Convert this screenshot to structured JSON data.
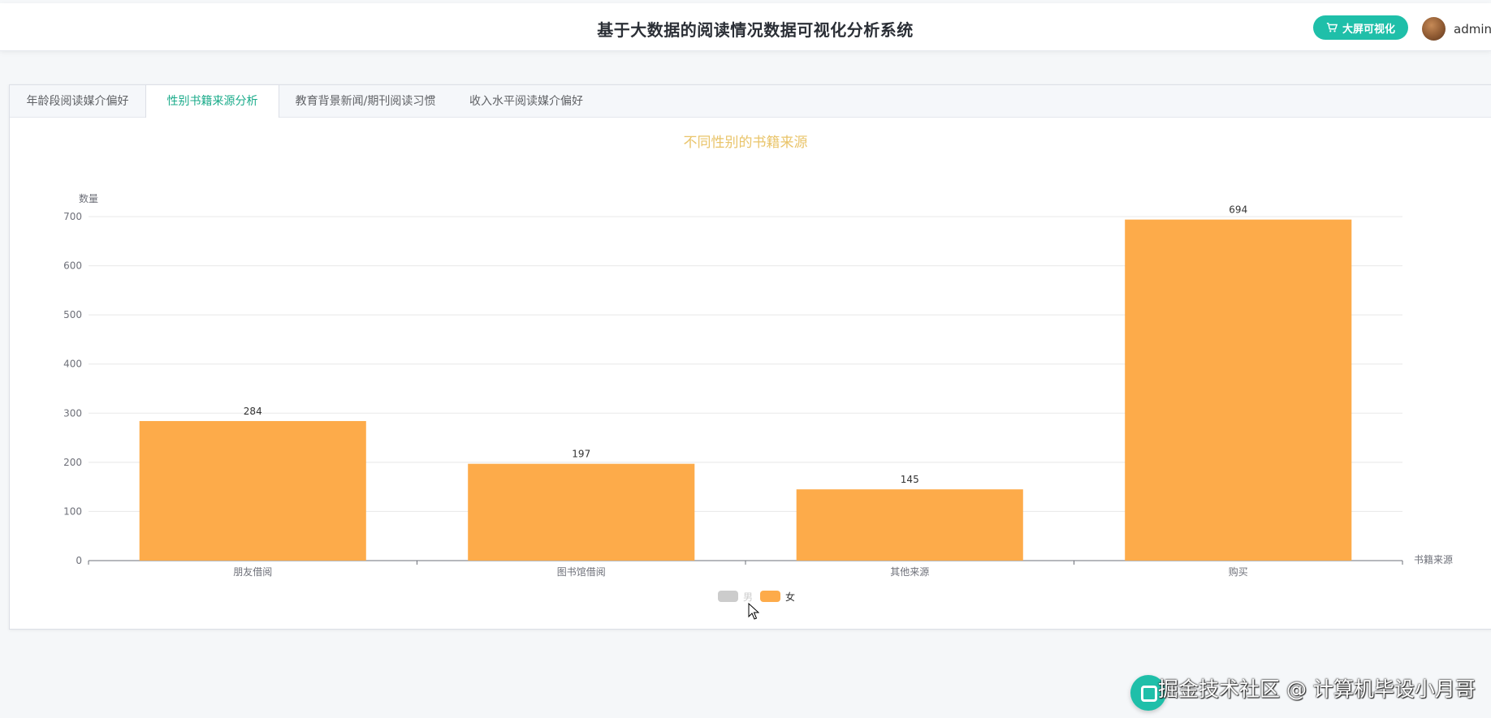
{
  "header": {
    "title": "基于大数据的阅读情况数据可视化分析系统",
    "bigscreen_label": "大屏可视化",
    "user_name": "admin",
    "accent_color": "#1fbfa9"
  },
  "tabs": [
    {
      "label": "年龄段阅读媒介偏好",
      "active": false
    },
    {
      "label": "性别书籍来源分析",
      "active": true
    },
    {
      "label": "教育背景新闻/期刊阅读习惯",
      "active": false
    },
    {
      "label": "收入水平阅读媒介偏好",
      "active": false
    }
  ],
  "chart_data": {
    "type": "bar",
    "title": "不同性别的书籍来源",
    "xlabel": "书籍来源",
    "ylabel": "数量",
    "categories": [
      "朋友借阅",
      "图书馆借阅",
      "其他来源",
      "购买"
    ],
    "series": [
      {
        "name": "男",
        "values": [],
        "color": "#cccccc",
        "visible": false
      },
      {
        "name": "女",
        "values": [
          284,
          197,
          145,
          694
        ],
        "color": "#fdab4a",
        "visible": true
      }
    ],
    "ylim": [
      0,
      700
    ],
    "yticks": [
      0,
      100,
      200,
      300,
      400,
      500,
      600,
      700
    ],
    "grid": true,
    "legend_position": "bottom-center",
    "title_color": "#e9c46a"
  },
  "watermark": "掘金技术社区 @ 计算机毕设小月哥"
}
